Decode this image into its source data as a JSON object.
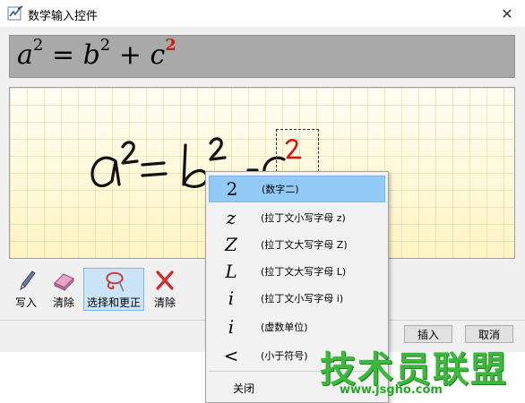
{
  "window": {
    "title": "数学输入控件",
    "close_glyph": "✕"
  },
  "preview": {
    "formula_parts": {
      "a": "a",
      "a_exp": "2",
      "eq": "=",
      "b": "b",
      "b_exp": "2",
      "plus": "+",
      "c": "c",
      "c_exp": "2"
    },
    "highlight_color": "#e01010"
  },
  "toolbar": {
    "buttons": [
      {
        "label": "写入",
        "icon": "pen-icon"
      },
      {
        "label": "清除",
        "icon": "eraser-icon"
      },
      {
        "label": "选择和更正",
        "icon": "lasso-icon",
        "active": true
      },
      {
        "label": "清除",
        "icon": "delete-x-icon"
      }
    ]
  },
  "actions": {
    "insert": "插入",
    "cancel": "取消"
  },
  "context_menu": {
    "items": [
      {
        "symbol": "2",
        "italic": false,
        "description": "(数字二)",
        "highlighted": true
      },
      {
        "symbol": "z",
        "italic": true,
        "description": "(拉丁文小写字母 z)"
      },
      {
        "symbol": "Z",
        "italic": true,
        "description": "(拉丁文大写字母 Z)"
      },
      {
        "symbol": "L",
        "italic": true,
        "description": "(拉丁文大写字母 L)"
      },
      {
        "symbol": "i",
        "italic": true,
        "description": "(拉丁文小写字母 i)"
      },
      {
        "symbol": "i",
        "italic": true,
        "description": "(虚数单位)"
      },
      {
        "symbol": "<",
        "italic": false,
        "description": "(小于符号)"
      }
    ],
    "close": "关闭"
  },
  "watermark": {
    "main": "技术员联盟",
    "sub": "www.jsgho.com"
  }
}
